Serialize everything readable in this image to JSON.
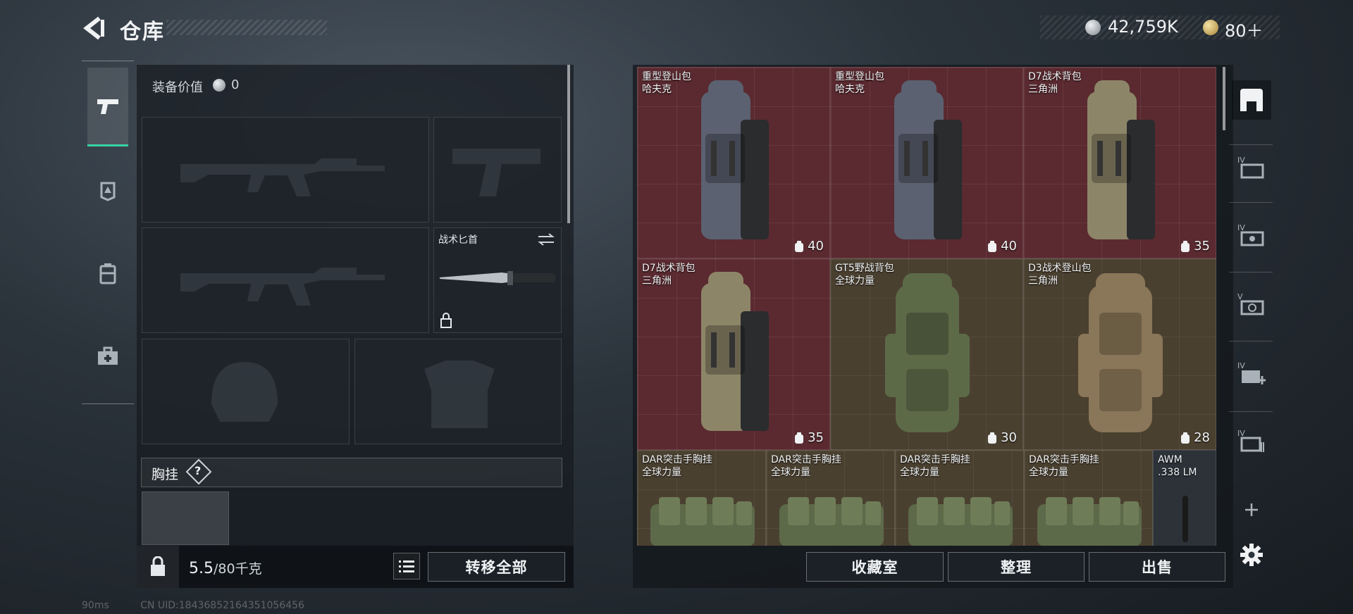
{
  "header": {
    "title": "仓库",
    "currency": [
      {
        "icon": "silver-coin-icon",
        "value": "42,759K"
      },
      {
        "icon": "gold-coin-icon",
        "value": "80＋"
      }
    ]
  },
  "left_rail": {
    "tabs": [
      {
        "icon": "pistol-icon",
        "active": true
      },
      {
        "icon": "helmet-badge-icon",
        "active": false
      },
      {
        "icon": "vest-icon",
        "active": false
      },
      {
        "icon": "medkit-case-icon",
        "active": false
      }
    ]
  },
  "equipment": {
    "value_label": "装备价值",
    "value": "0",
    "knife_slot_label": "战术匕首",
    "rig_label": "胸挂",
    "rig_help": "?"
  },
  "bottom_left": {
    "weight_current": "5.5",
    "weight_max": "/80千克",
    "transfer_all": "转移全部"
  },
  "status": {
    "ping": "90ms",
    "uid": "CN UID:18436852164351056456"
  },
  "stash": {
    "items": [
      {
        "name": "重型登山包",
        "brand": "哈夫克",
        "capacity": "40"
      },
      {
        "name": "重型登山包",
        "brand": "哈夫克",
        "capacity": "40"
      },
      {
        "name": "D7战术背包",
        "brand": "三角洲",
        "capacity": "35"
      },
      {
        "name": "D7战术背包",
        "brand": "三角洲",
        "capacity": "35"
      },
      {
        "name": "GT5野战背包",
        "brand": "全球力量",
        "capacity": "30"
      },
      {
        "name": "D3战术登山包",
        "brand": "三角洲",
        "capacity": "28"
      },
      {
        "name": "DAR突击手胸挂",
        "brand": "全球力量"
      },
      {
        "name": "DAR突击手胸挂",
        "brand": "全球力量"
      },
      {
        "name": "DAR突击手胸挂",
        "brand": "全球力量"
      },
      {
        "name": "DAR突击手胸挂",
        "brand": "全球力量"
      },
      {
        "name": "AWM",
        "brand": ".338 LM"
      }
    ],
    "buttons": {
      "collection": "收藏室",
      "sort": "整理",
      "sell": "出售"
    }
  },
  "right_rail": {
    "icons": [
      "safe-box-icon",
      "stash-tab-1-icon",
      "stash-tab-2-icon",
      "stash-tab-3-icon",
      "stash-tab-4-icon",
      "stash-tab-5-icon",
      "add-tab-icon",
      "settings-gear-icon"
    ]
  },
  "colors": {
    "accent": "#37d3a4",
    "rare_red": "#5a2a30",
    "olive": "#4a4030"
  }
}
